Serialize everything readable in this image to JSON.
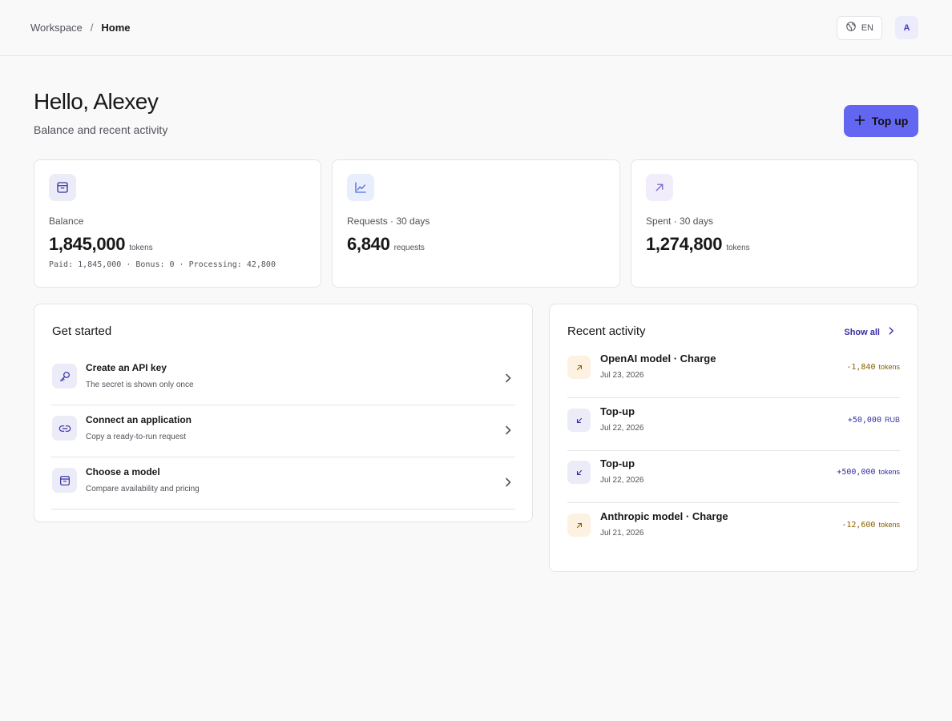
{
  "header": {
    "breadcrumb": {
      "parent": "Workspace",
      "separator": "/",
      "current": "Home"
    },
    "language": "EN",
    "avatar_initial": "A"
  },
  "page": {
    "greeting": "Hello, Alexey",
    "subtitle": "Balance and recent activity",
    "topup_label": "Top up"
  },
  "stats": [
    {
      "icon": "wallet-icon",
      "label": "Balance",
      "value": "1,845,000",
      "unit": "tokens",
      "detail": "Paid: 1,845,000 · Bonus: 0 · Processing: 42,800"
    },
    {
      "icon": "line-chart-icon",
      "label": "Requests · 30 days",
      "value": "6,840",
      "unit": "requests"
    },
    {
      "icon": "arrow-up-right-icon",
      "label": "Spent · 30 days",
      "value": "1,274,800",
      "unit": "tokens"
    }
  ],
  "get_started": {
    "title": "Get started",
    "items": [
      {
        "icon": "key-icon",
        "title": "Create an API key",
        "description": "The secret is shown only once"
      },
      {
        "icon": "link-icon",
        "title": "Connect an application",
        "description": "Copy a ready-to-run request"
      },
      {
        "icon": "box-icon",
        "title": "Choose a model",
        "description": "Compare availability and pricing"
      }
    ]
  },
  "recent_activity": {
    "title": "Recent activity",
    "show_all": "Show all",
    "items": [
      {
        "type": "charge",
        "title": "OpenAI model · Charge",
        "date": "Jul 23, 2026",
        "amount": "-1,840",
        "unit": "tokens"
      },
      {
        "type": "topup",
        "title": "Top-up",
        "date": "Jul 22, 2026",
        "amount": "+50,000",
        "unit": "RUB"
      },
      {
        "type": "topup",
        "title": "Top-up",
        "date": "Jul 22, 2026",
        "amount": "+500,000",
        "unit": "tokens"
      },
      {
        "type": "charge",
        "title": "Anthropic model · Charge",
        "date": "Jul 21, 2026",
        "amount": "-12,600",
        "unit": "tokens"
      }
    ]
  },
  "colors": {
    "accent": "#6366f1",
    "charge_text": "#8a6100",
    "charge_bg": "#fdf1e1",
    "topup_text": "#3730a3",
    "topup_bg": "#ececf8"
  }
}
